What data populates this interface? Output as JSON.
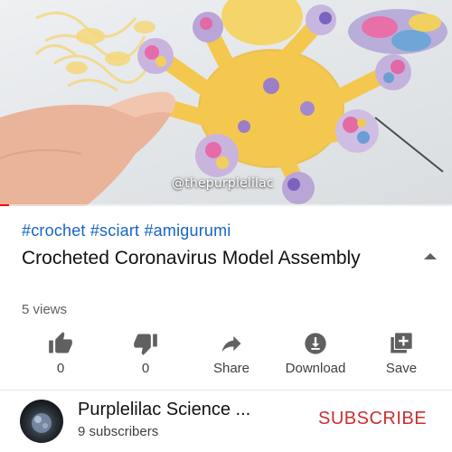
{
  "video": {
    "watermark": "@thepurplelilac",
    "progress_fraction": 0.02
  },
  "info": {
    "hashtags": "#crochet #sciart #amigurumi",
    "title": "Crocheted Coronavirus Model Assembly",
    "views": "5 views"
  },
  "actions": [
    {
      "name": "like",
      "icon": "thumbs-up-icon",
      "label": "0"
    },
    {
      "name": "dislike",
      "icon": "thumbs-down-icon",
      "label": "0"
    },
    {
      "name": "share",
      "icon": "share-arrow-icon",
      "label": "Share"
    },
    {
      "name": "download",
      "icon": "download-icon",
      "label": "Download"
    },
    {
      "name": "save",
      "icon": "playlist-add-icon",
      "label": "Save"
    }
  ],
  "channel": {
    "name": "Purplelilac Science ...",
    "subscribers": "9 subscribers",
    "subscribe_label": "SUBSCRIBE"
  },
  "colors": {
    "hashtag": "#1565c0",
    "subscribe": "#cc2f2f",
    "icon": "#606060"
  }
}
